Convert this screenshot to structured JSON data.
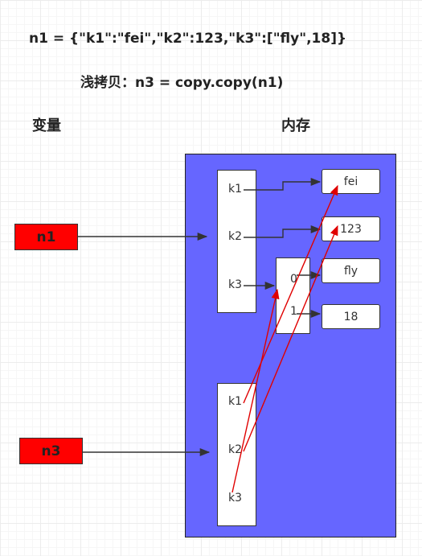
{
  "code_line": "n1 = {\"k1\":\"fei\",\"k2\":123,\"k3\":[\"fly\",18]}",
  "shallow_copy_line": "浅拷贝：n3 = copy.copy(n1)",
  "headings": {
    "variables": "变量",
    "memory": "内存"
  },
  "variables": {
    "n1": "n1",
    "n3": "n3"
  },
  "n1_keys": [
    "k1",
    "k2",
    "k3"
  ],
  "n3_keys": [
    "k1",
    "k2",
    "k3"
  ],
  "list_indices": [
    "0",
    "1"
  ],
  "values": {
    "fei": "fei",
    "num123": "123",
    "fly": "fly",
    "num18": "18"
  },
  "colors": {
    "memory_bg": "#6666ff",
    "var_box": "#ff0000",
    "reference_arrow": "#ff0000",
    "link_arrow": "#333333"
  }
}
